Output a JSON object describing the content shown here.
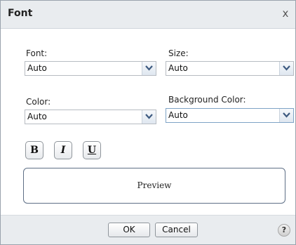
{
  "dialog": {
    "title": "Font",
    "close_label": "x"
  },
  "font": {
    "label": "Font:",
    "value": "Auto"
  },
  "size": {
    "label": "Size:",
    "value": "Auto"
  },
  "color": {
    "label": "Color:",
    "value": "Auto"
  },
  "background_color": {
    "label": "Background Color:",
    "value": "Auto"
  },
  "format_buttons": {
    "bold": "B",
    "italic": "I",
    "underline": "U"
  },
  "preview": {
    "text": "Preview"
  },
  "footer": {
    "ok_label": "OK",
    "cancel_label": "Cancel",
    "help_label": "?"
  },
  "icons": {
    "dropdown": "chevron-down-icon",
    "close": "close-icon",
    "help": "help-icon"
  }
}
